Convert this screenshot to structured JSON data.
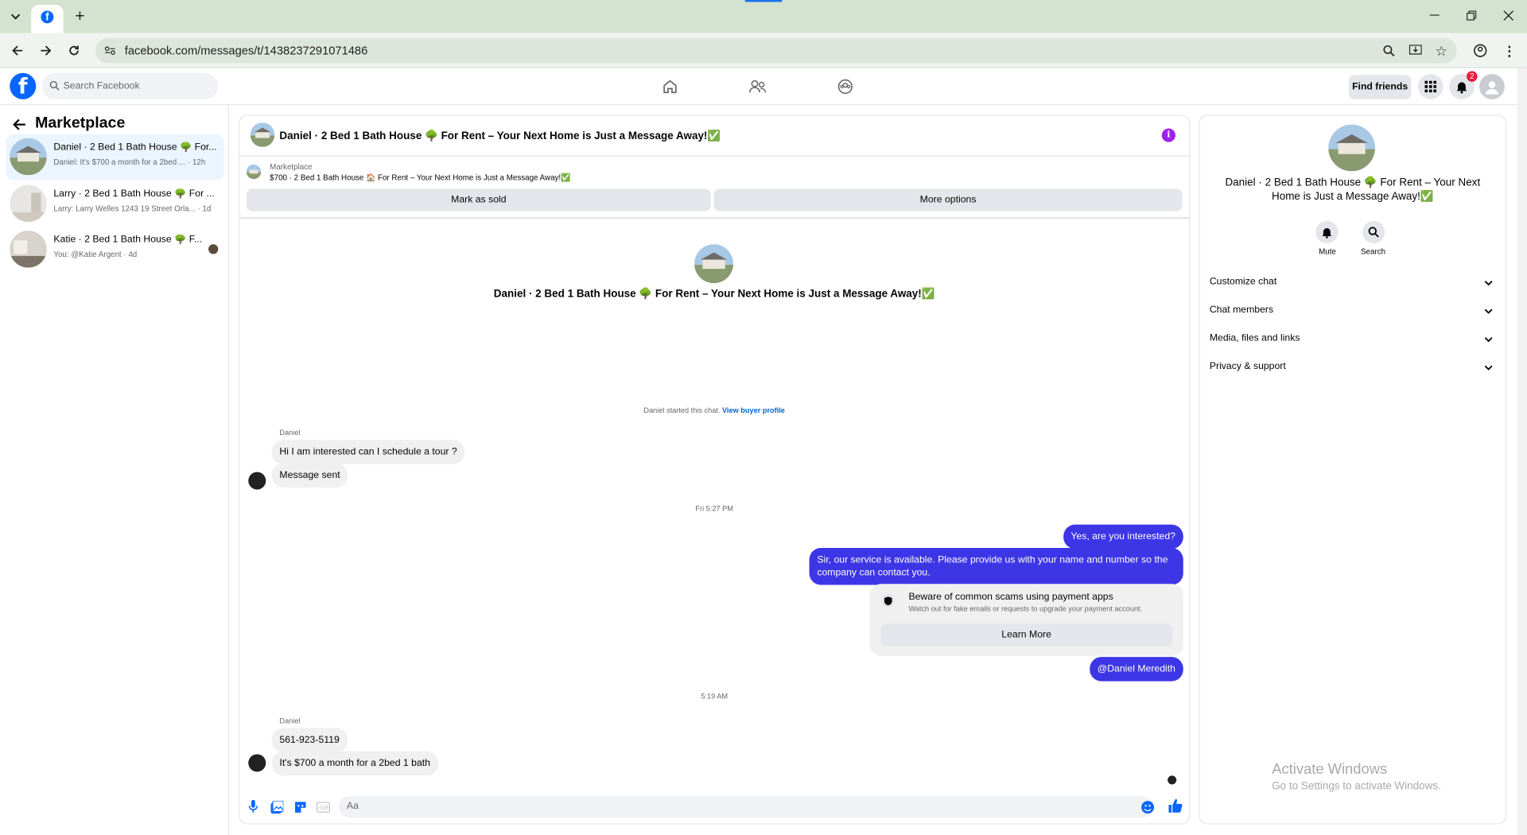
{
  "browser": {
    "url": "facebook.com/messages/t/1438237291071486"
  },
  "facebook": {
    "search_placeholder": "Search Facebook",
    "find_friends": "Find friends",
    "notification_count": "2"
  },
  "sidebar": {
    "title": "Marketplace",
    "threads": [
      {
        "name": "Daniel · 2 Bed 1 Bath House 🌳 For...",
        "preview": "Daniel: It's $700 a month for a 2bed ... · 12h"
      },
      {
        "name": "Larry · 2 Bed 1 Bath House 🌳 For ...",
        "preview": "Larry: Larry Welles 1243 19 Street Orla... · 1d"
      },
      {
        "name": "Katie · 2 Bed 1 Bath House 🌳 F...",
        "preview": "You: @Katie Argent · 4d"
      }
    ]
  },
  "chat": {
    "header_title": "Daniel · 2 Bed 1 Bath House 🌳 For Rent – Your Next Home is Just a Message Away!✅",
    "listing_label": "Marketplace",
    "listing_line": "$700 · 2 Bed 1 Bath House 🏠 For Rent – Your Next Home is Just a Message Away!✅",
    "mark_sold": "Mark as sold",
    "more_options": "More options",
    "intro_title": "Daniel · 2 Bed 1 Bath House 🌳 For Rent – Your Next Home is Just a Message Away!✅",
    "started_text": "Daniel started this chat.",
    "view_profile": "View buyer profile",
    "sender_name_1": "Daniel",
    "msg_in_1": "Hi I am interested can I schedule a tour ?",
    "msg_in_2": "Message sent",
    "time_1": "Fri 5:27 PM",
    "msg_out_1": "Yes, are you interested?",
    "msg_out_2": "Sir, our service is available. Please provide us with your name and number so the company can contact you.",
    "scam_title": "Beware of common scams using payment apps",
    "scam_text": "Watch out for fake emails or requests to upgrade your payment account.",
    "learn_more": "Learn More",
    "msg_out_3": "@Daniel Meredith",
    "time_2": "5:19 AM",
    "sender_name_2": "Daniel",
    "msg_in_3": "561-923-5119",
    "msg_in_4": "It's $700 a month for a 2bed 1 bath",
    "composer_placeholder": "Aa"
  },
  "info_panel": {
    "title": "Daniel · 2 Bed 1 Bath House 🌳 For Rent – Your Next Home is Just a Message Away!✅",
    "mute": "Mute",
    "search": "Search",
    "sections": [
      "Customize chat",
      "Chat members",
      "Media, files and links",
      "Privacy & support"
    ]
  },
  "os_watermark": {
    "line1": "Activate Windows",
    "line2": "Go to Settings to activate Windows."
  },
  "colors": {
    "accent": "#0866ff",
    "outgoing_bubble": "#3d36e6",
    "link": "#0064d1"
  }
}
